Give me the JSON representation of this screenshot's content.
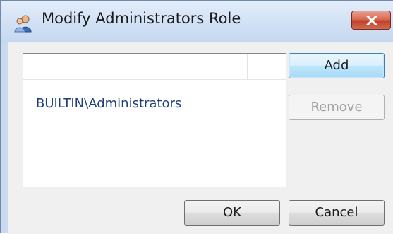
{
  "window": {
    "title": "Modify Administrators Role",
    "close_icon": "close-x-icon",
    "title_icon": "users-role-icon"
  },
  "list": {
    "columns": [
      "",
      ""
    ],
    "items": [
      "BUILTIN\\Administrators"
    ]
  },
  "buttons": {
    "add": "Add",
    "remove": "Remove",
    "ok": "OK",
    "cancel": "Cancel"
  },
  "colors": {
    "close_button": "#c1412a",
    "default_button_border": "#3c7fb1",
    "list_item_text": "#1f3f7a"
  }
}
